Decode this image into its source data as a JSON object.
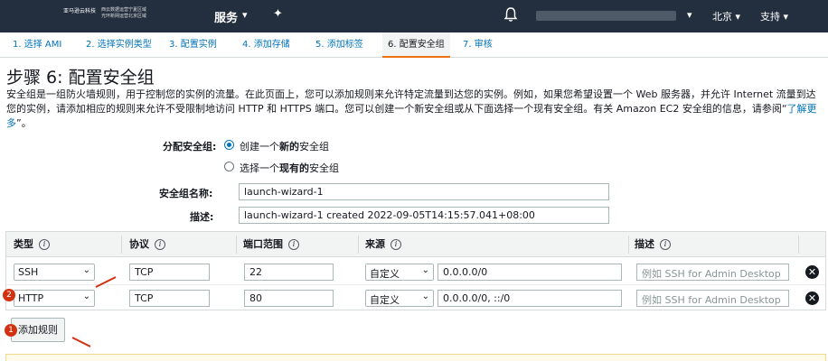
{
  "topnav": {
    "logo_text": "亚马逊云科技",
    "logo_sub_line1": "西云数据运营宁夏区域",
    "logo_sub_line2": "光环新网运营北京区域",
    "services": "服务",
    "caret": "▾",
    "region": "北京",
    "support": "支持"
  },
  "steps": [
    "1. 选择 AMI",
    "2. 选择实例类型",
    "3. 配置实例",
    "4. 添加存储",
    "5. 添加标签",
    "6. 配置安全组",
    "7. 审核"
  ],
  "page": {
    "title": "步骤 6: 配置安全组",
    "description": "安全组是一组防火墙规则，用于控制您的实例的流量。在此页面上，您可以添加规则来允许特定流量到达您的实例。例如，如果您希望设置一个 Web 服务器，并允许 Internet 流量到达您的实例，请添加相应的规则来允许不受限制地访问 HTTP 和 HTTPS 端口。您可以创建一个新安全组或从下面选择一个现有安全组。有关 Amazon EC2 安全组的信息，请参阅“",
    "learn_more": "了解更多",
    "description_end": "”。"
  },
  "form": {
    "assign_label": "分配安全组:",
    "option_new_pre": "创建一个",
    "option_new_bold": "新的",
    "option_new_post": "安全组",
    "option_existing_pre": "选择一个",
    "option_existing_bold": "现有的",
    "option_existing_post": "安全组",
    "name_label": "安全组名称:",
    "name_value": "launch-wizard-1",
    "desc_label": "描述:",
    "desc_value": "launch-wizard-1 created 2022-09-05T14:15:57.041+08:00"
  },
  "table": {
    "headers": [
      "类型",
      "协议",
      "端口范围",
      "来源",
      "描述"
    ],
    "info_glyph": "i",
    "rows": [
      {
        "type": "SSH",
        "protocol": "TCP",
        "port": "22",
        "source_type": "自定义",
        "source": "0.0.0.0/0",
        "desc_placeholder": "例如 SSH for Admin Desktop"
      },
      {
        "type": "HTTP",
        "protocol": "TCP",
        "port": "80",
        "source_type": "自定义",
        "source": "0.0.0.0/0, ::/0",
        "desc_placeholder": "例如 SSH for Admin Desktop"
      }
    ],
    "remove_glyph": "✕"
  },
  "add_rule": "添加规则",
  "badges": [
    "1",
    "2"
  ],
  "colors": {
    "nav_bg": "#232f3e",
    "link": "#0073bb",
    "accent": "#ec7211",
    "badge": "#d13212"
  }
}
